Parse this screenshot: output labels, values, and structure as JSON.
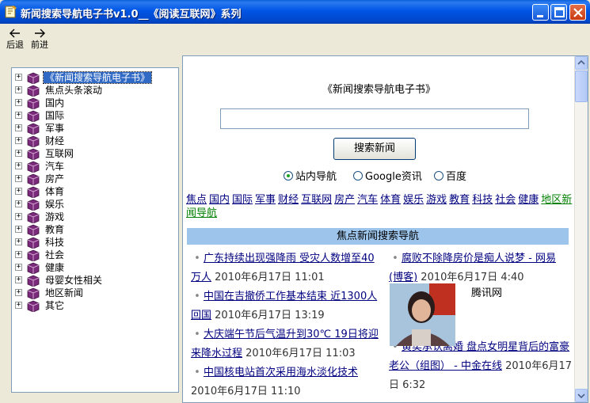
{
  "window": {
    "title": "新闻搜索导航电子书v1.0__《阅读互联网》系列"
  },
  "toolbar": {
    "back_label": "后退",
    "forward_label": "前进"
  },
  "tree": {
    "items": [
      {
        "label": "《新闻搜索导航电子书》",
        "selected": true
      },
      {
        "label": "焦点头条滚动"
      },
      {
        "label": "国内"
      },
      {
        "label": "国际"
      },
      {
        "label": "军事"
      },
      {
        "label": "财经"
      },
      {
        "label": "互联网"
      },
      {
        "label": "汽车"
      },
      {
        "label": "房产"
      },
      {
        "label": "体育"
      },
      {
        "label": "娱乐"
      },
      {
        "label": "游戏"
      },
      {
        "label": "教育"
      },
      {
        "label": "科技"
      },
      {
        "label": "社会"
      },
      {
        "label": "健康"
      },
      {
        "label": "母婴女性相关"
      },
      {
        "label": "地区新闻"
      },
      {
        "label": "其它"
      }
    ],
    "expander_glyph": "+",
    "book_icon_color": "#7a2a7a"
  },
  "page": {
    "title": "《新闻搜索导航电子书》",
    "search": {
      "value": "",
      "button_label": "搜索新闻"
    },
    "radios": [
      {
        "label": "站内导航",
        "checked": true
      },
      {
        "label": "Google资讯",
        "checked": false
      },
      {
        "label": "百度",
        "checked": false
      }
    ],
    "categories": [
      "焦点",
      "国内",
      "国际",
      "军事",
      "财经",
      "互联网",
      "房产",
      "汽车",
      "体育",
      "娱乐",
      "游戏",
      "教育",
      "科技",
      "社会",
      "健康",
      "地区新闻导航"
    ],
    "nav_bar_title": "焦点新闻搜索导航",
    "news_left": [
      {
        "title": "广东持续出现强降雨 受灾人数增至40万人",
        "date": "2010年6月17日 11:01"
      },
      {
        "title": "中国在吉撤侨工作基本结束 近1300人回国",
        "date": "2010年6月17日 13:19"
      },
      {
        "title": "大庆端午节后气温升到30℃ 19日将迎来降水过程",
        "date": "2010年6月17日 11:03"
      },
      {
        "title": "中国核电站首次采用海水淡化技术",
        "date": "2010年6月17日 11:10"
      }
    ],
    "news_right": [
      {
        "title": "腐败不除降房价是痴人说梦 - 网易 (博客)",
        "date": "2010年6月17日 4:40"
      },
      {
        "title": "黄奕承认离婚 盘点女明星背后的富豪老公（组图） - 中金在线",
        "date": "2010年6月17日 6:32"
      }
    ],
    "photo_caption": "腾讯网"
  },
  "colors": {
    "titlebar": "#0055e5",
    "nav_bar": "#9dc5ec",
    "link": "#000080",
    "link_green": "#008000",
    "selection": "#316ac5"
  }
}
